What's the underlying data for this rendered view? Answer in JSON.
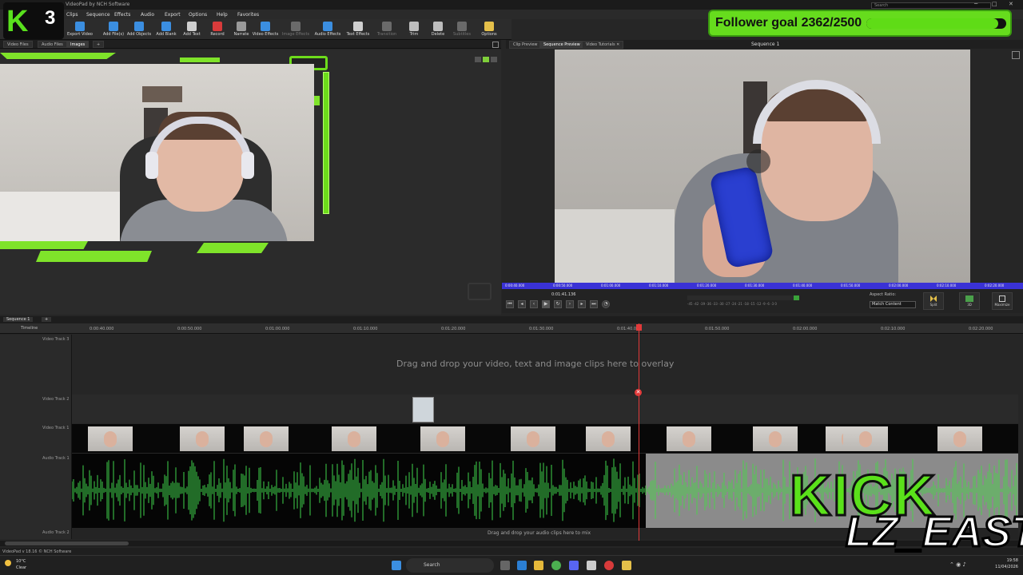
{
  "window": {
    "title": "VideoPad by NCH Software",
    "search_placeholder": "Search",
    "minimize": "─",
    "maximize": "□",
    "close": "✕"
  },
  "menu": [
    "Clips",
    "Sequence",
    "Effects",
    "Audio",
    "Export",
    "Options",
    "Help",
    "Favorites"
  ],
  "toolbar": {
    "items": [
      {
        "label": "Project",
        "color": "#3b8ee0"
      },
      {
        "label": "Export Video",
        "color": "#3b8ee0"
      },
      {
        "label": "Add File(s)",
        "color": "#3b8ee0"
      },
      {
        "label": "Add Objects",
        "color": "#3b8ee0"
      },
      {
        "label": "Add Blank",
        "color": "#3b8ee0"
      },
      {
        "label": "Add Text",
        "color": "#cfcfcf"
      },
      {
        "label": "Record",
        "color": "#d83b3b"
      },
      {
        "label": "Narrate",
        "color": "#9a9a9a"
      },
      {
        "label": "Video Effects",
        "color": "#3b8ee0"
      },
      {
        "label": "Image Effects",
        "color": "#6a6a6a"
      },
      {
        "label": "Audio Effects",
        "color": "#3b8ee0"
      },
      {
        "label": "Text Effects",
        "color": "#cfcfcf"
      },
      {
        "label": "Transition",
        "color": "#6a6a6a"
      },
      {
        "label": "Trim",
        "color": "#bdbdbd"
      },
      {
        "label": "Delete",
        "color": "#bdbdbd"
      },
      {
        "label": "Subtitles",
        "color": "#6a6a6a"
      },
      {
        "label": "Options",
        "color": "#e5c04a"
      }
    ]
  },
  "bin_tabs": [
    "Video Files",
    "Audio Files",
    "Images",
    "+"
  ],
  "preview_tabs": [
    "Clip Preview",
    "Sequence Preview",
    "Video Tutorials ✕"
  ],
  "preview": {
    "sequence_title": "Sequence 1",
    "timecode": "0:01:41.136",
    "ruler_labels": [
      "0:00:40.000",
      "0:00:50.000",
      "0:01:00.000",
      "0:01:10.000",
      "0:01:20.000",
      "0:01:30.000",
      "0:01:40.000",
      "0:01:50.000",
      "0:02:00.000",
      "0:02:10.000",
      "0:02:20.000"
    ],
    "meter_labels": "-45 -42 -39 -36 -33 -30 -27 -24 -21 -18 -15 -12 -9 -6 -3 0",
    "aspect_label": "Aspect Ratio:",
    "aspect_value": "Match Content",
    "split_label": "Split",
    "threed_label": "3D",
    "maximize_label": "Maximize"
  },
  "follower_goal": {
    "text": "Follower goal 2362/2500",
    "current": 2362,
    "target": 2500
  },
  "kick_badge": {
    "letter": "K",
    "number": "3"
  },
  "timeline": {
    "sequence_tab": "Sequence 1",
    "add_tab": "+",
    "label": "Timeline",
    "ruler_labels": [
      "0:00:40.000",
      "0:00:50.000",
      "0:01:00.000",
      "0:01:10.000",
      "0:01:20.000",
      "0:01:30.000",
      "0:01:40.000",
      "0:01:50.000",
      "0:02:00.000",
      "0:02:10.000",
      "0:02:20.000"
    ],
    "tracks": {
      "video3": "Video Track 3",
      "video2": "Video Track 2",
      "video1": "Video Track 1",
      "audio1": "Audio Track 1",
      "audio2": "Audio Track 2"
    },
    "overlay_message": "Drag and drop your video, text and image clips here to overlay",
    "audio_message": "Drag and drop your audio clips here to mix",
    "playhead_marker": "✕"
  },
  "overlay": {
    "kick_text": "KICK",
    "streamer_name": "LZ_EAST"
  },
  "status": {
    "text": "VideoPad v 18.16 © NCH Software"
  },
  "taskbar": {
    "weather_temp": "10°C",
    "weather_desc": "Clear",
    "search": "Search",
    "time": "19:58",
    "date": "11/04/2026"
  }
}
